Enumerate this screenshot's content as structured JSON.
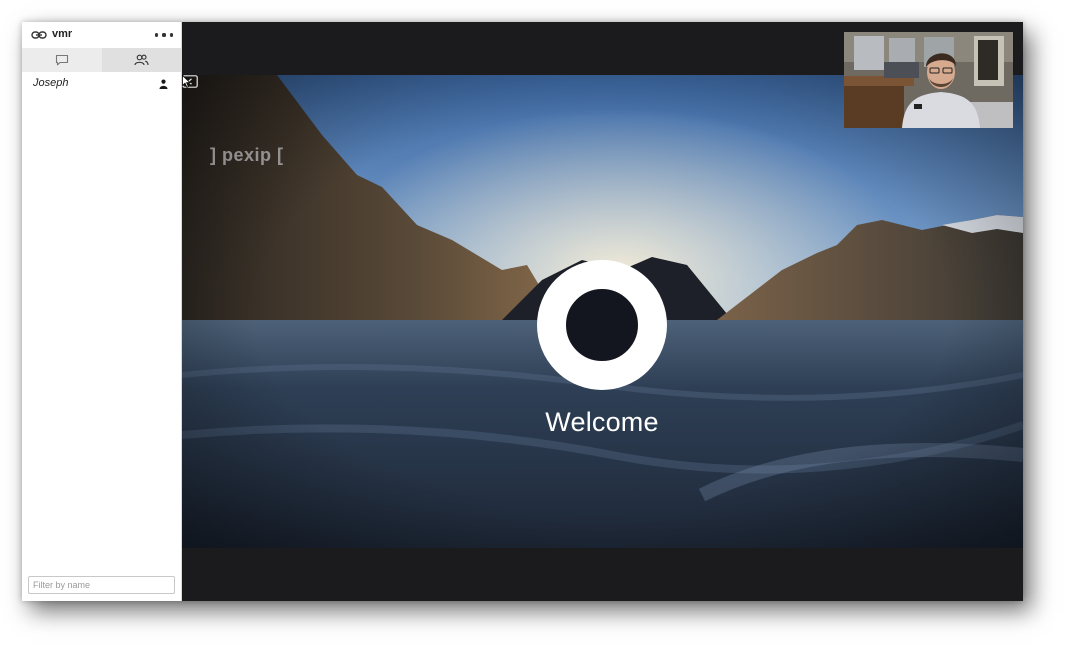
{
  "sidebar": {
    "room_name": "vmr",
    "more_icon": "ellipsis-icon",
    "tabs": [
      {
        "name": "chat",
        "icon": "chat-bubble-icon"
      },
      {
        "name": "participants",
        "icon": "people-icon"
      }
    ],
    "participants": [
      {
        "name": "Joseph",
        "role_icon": "person-icon"
      }
    ],
    "filter": {
      "placeholder": "Filter by name",
      "value": ""
    }
  },
  "stage": {
    "logo_text": "] pexip [",
    "welcome_text": "Welcome",
    "collapse_icon": "collapse-sidebar-icon"
  },
  "colors": {
    "stage_background": "#1b1b1d",
    "sidebar_background": "#ffffff",
    "welcome_ring": "#ffffff"
  }
}
